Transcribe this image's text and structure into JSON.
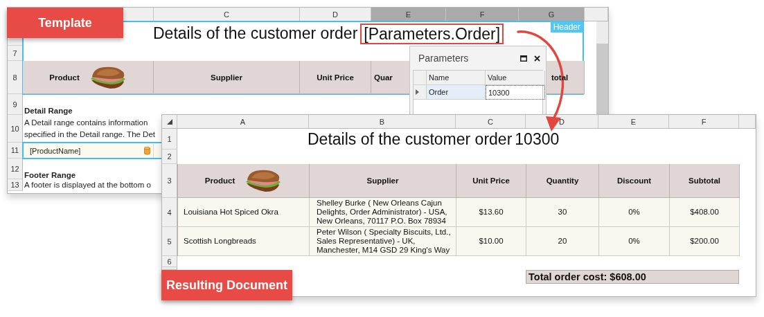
{
  "template_sheet": {
    "label": "Template",
    "column_headers": [
      {
        "label": "C",
        "selected": false
      },
      {
        "label": "D",
        "selected": false
      },
      {
        "label": "E",
        "selected": true
      },
      {
        "label": "F",
        "selected": true
      },
      {
        "label": "G",
        "selected": true
      }
    ],
    "row_numbers": [
      "7",
      "8",
      "9",
      "10",
      "11",
      "12",
      "13"
    ],
    "title": "Details of the customer order",
    "title_parameter": "[Parameters.Order]",
    "range_tag": "Header",
    "table_headers": [
      "Product",
      "Supplier",
      "Unit Price",
      "Quar",
      "total"
    ],
    "detail_heading": "Detail Range",
    "detail_text": [
      "A Detail range contains information",
      "specified in the Detail range. The Det"
    ],
    "detail_field": "[ProductName]",
    "footer_heading": "Footer Range",
    "footer_text": "A footer is displayed at the bottom o"
  },
  "parameters_panel": {
    "title": "Parameters",
    "columns": [
      "Name",
      "Value"
    ],
    "rows": [
      {
        "name": "Order",
        "value": "10300",
        "selected": true
      }
    ]
  },
  "result_sheet": {
    "label": "Resulting Document",
    "column_headers": [
      "A",
      "B",
      "C",
      "D",
      "E",
      "F"
    ],
    "row_numbers": [
      "1",
      "2",
      "3",
      "4",
      "5",
      "6"
    ],
    "title": "Details of the customer order",
    "title_value": "10300",
    "table_headers": [
      "Product",
      "Supplier",
      "Unit Price",
      "Quantity",
      "Discount",
      "Subtotal"
    ],
    "rows": [
      {
        "product": "Louisiana Hot Spiced Okra",
        "supplier": [
          "Shelley Burke ( New Orleans Cajun",
          "Delights, Order Administrator)  -  USA,",
          "New Orleans, 70117  P.O. Box 78934"
        ],
        "unit_price": "$13.60",
        "quantity": "30",
        "discount": "0%",
        "subtotal": "$408.00"
      },
      {
        "product": "Scottish Longbreads",
        "supplier": [
          "Peter Wilson ( Specialty Biscuits, Ltd.,",
          "Sales Representative)  -  UK,",
          "Manchester, M14 GSD  29 King's Way"
        ],
        "unit_price": "$10.00",
        "quantity": "20",
        "discount": "0%",
        "subtotal": "$200.00"
      }
    ],
    "total": "Total order cost: $608.00"
  }
}
